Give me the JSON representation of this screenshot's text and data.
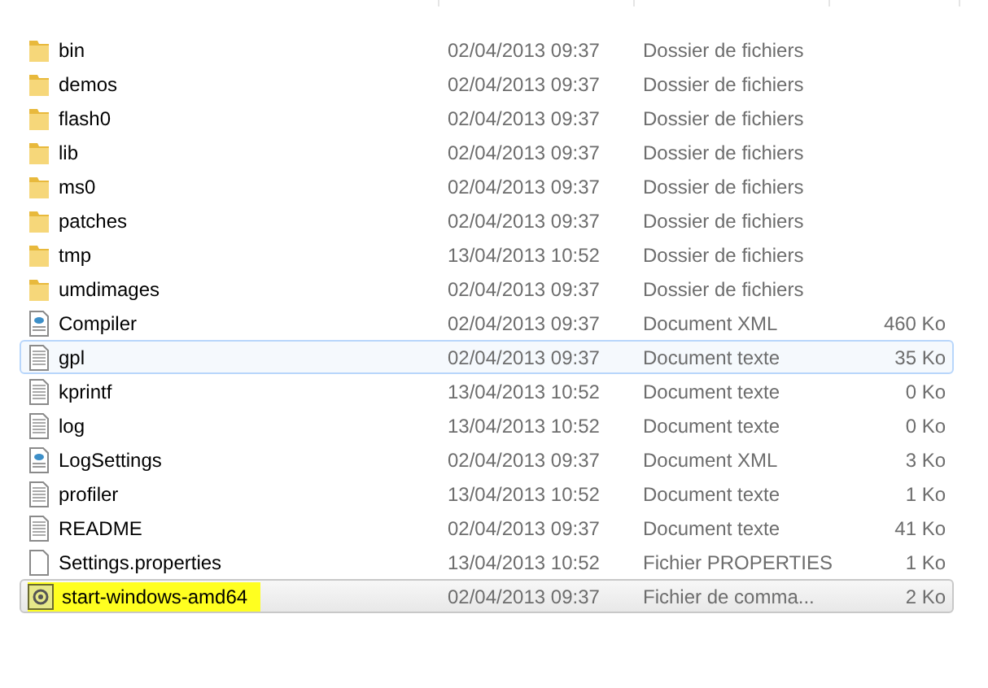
{
  "files": [
    {
      "kind": "folder",
      "name": "bin",
      "modified": "02/04/2013 09:37",
      "type": "Dossier de fichiers",
      "selected": false,
      "hovered": false,
      "highlighted": false
    },
    {
      "kind": "folder",
      "name": "demos",
      "modified": "02/04/2013 09:37",
      "type": "Dossier de fichiers",
      "selected": false,
      "hovered": false,
      "highlighted": false
    },
    {
      "kind": "folder",
      "name": "flash0",
      "modified": "02/04/2013 09:37",
      "type": "Dossier de fichiers",
      "selected": false,
      "hovered": false,
      "highlighted": false
    },
    {
      "kind": "folder",
      "name": "lib",
      "modified": "02/04/2013 09:37",
      "type": "Dossier de fichiers",
      "selected": false,
      "hovered": false,
      "highlighted": false
    },
    {
      "kind": "folder",
      "name": "ms0",
      "modified": "02/04/2013 09:37",
      "type": "Dossier de fichiers",
      "selected": false,
      "hovered": false,
      "highlighted": false
    },
    {
      "kind": "folder",
      "name": "patches",
      "modified": "02/04/2013 09:37",
      "type": "Dossier de fichiers",
      "selected": false,
      "hovered": false,
      "highlighted": false
    },
    {
      "kind": "folder",
      "name": "tmp",
      "modified": "13/04/2013 10:52",
      "type": "Dossier de fichiers",
      "selected": false,
      "hovered": false,
      "highlighted": false
    },
    {
      "kind": "folder",
      "name": "umdimages",
      "modified": "02/04/2013 09:37",
      "type": "Dossier de fichiers",
      "selected": false,
      "hovered": false,
      "highlighted": false
    },
    {
      "kind": "xml",
      "name": "Compiler",
      "modified": "02/04/2013 09:37",
      "type": "Document XML",
      "size": "460 Ko",
      "selected": false,
      "hovered": false,
      "highlighted": false
    },
    {
      "kind": "text",
      "name": "gpl",
      "modified": "02/04/2013 09:37",
      "type": "Document texte",
      "size": "35 Ko",
      "selected": false,
      "hovered": true,
      "highlighted": false
    },
    {
      "kind": "text",
      "name": "kprintf",
      "modified": "13/04/2013 10:52",
      "type": "Document texte",
      "size": "0 Ko",
      "selected": false,
      "hovered": false,
      "highlighted": false
    },
    {
      "kind": "text",
      "name": "log",
      "modified": "13/04/2013 10:52",
      "type": "Document texte",
      "size": "0 Ko",
      "selected": false,
      "hovered": false,
      "highlighted": false
    },
    {
      "kind": "xml",
      "name": "LogSettings",
      "modified": "02/04/2013 09:37",
      "type": "Document XML",
      "size": "3 Ko",
      "selected": false,
      "hovered": false,
      "highlighted": false
    },
    {
      "kind": "text",
      "name": "profiler",
      "modified": "13/04/2013 10:52",
      "type": "Document texte",
      "size": "1 Ko",
      "selected": false,
      "hovered": false,
      "highlighted": false
    },
    {
      "kind": "text",
      "name": "README",
      "modified": "02/04/2013 09:37",
      "type": "Document texte",
      "size": "41 Ko",
      "selected": false,
      "hovered": false,
      "highlighted": false
    },
    {
      "kind": "blank",
      "name": "Settings.properties",
      "modified": "13/04/2013 10:52",
      "type": "Fichier PROPERTIES",
      "size": "1 Ko",
      "selected": false,
      "hovered": false,
      "highlighted": false
    },
    {
      "kind": "command",
      "name": "start-windows-amd64",
      "modified": "02/04/2013 09:37",
      "type": "Fichier de comma...",
      "size": "2 Ko",
      "selected": true,
      "hovered": false,
      "highlighted": true
    }
  ]
}
